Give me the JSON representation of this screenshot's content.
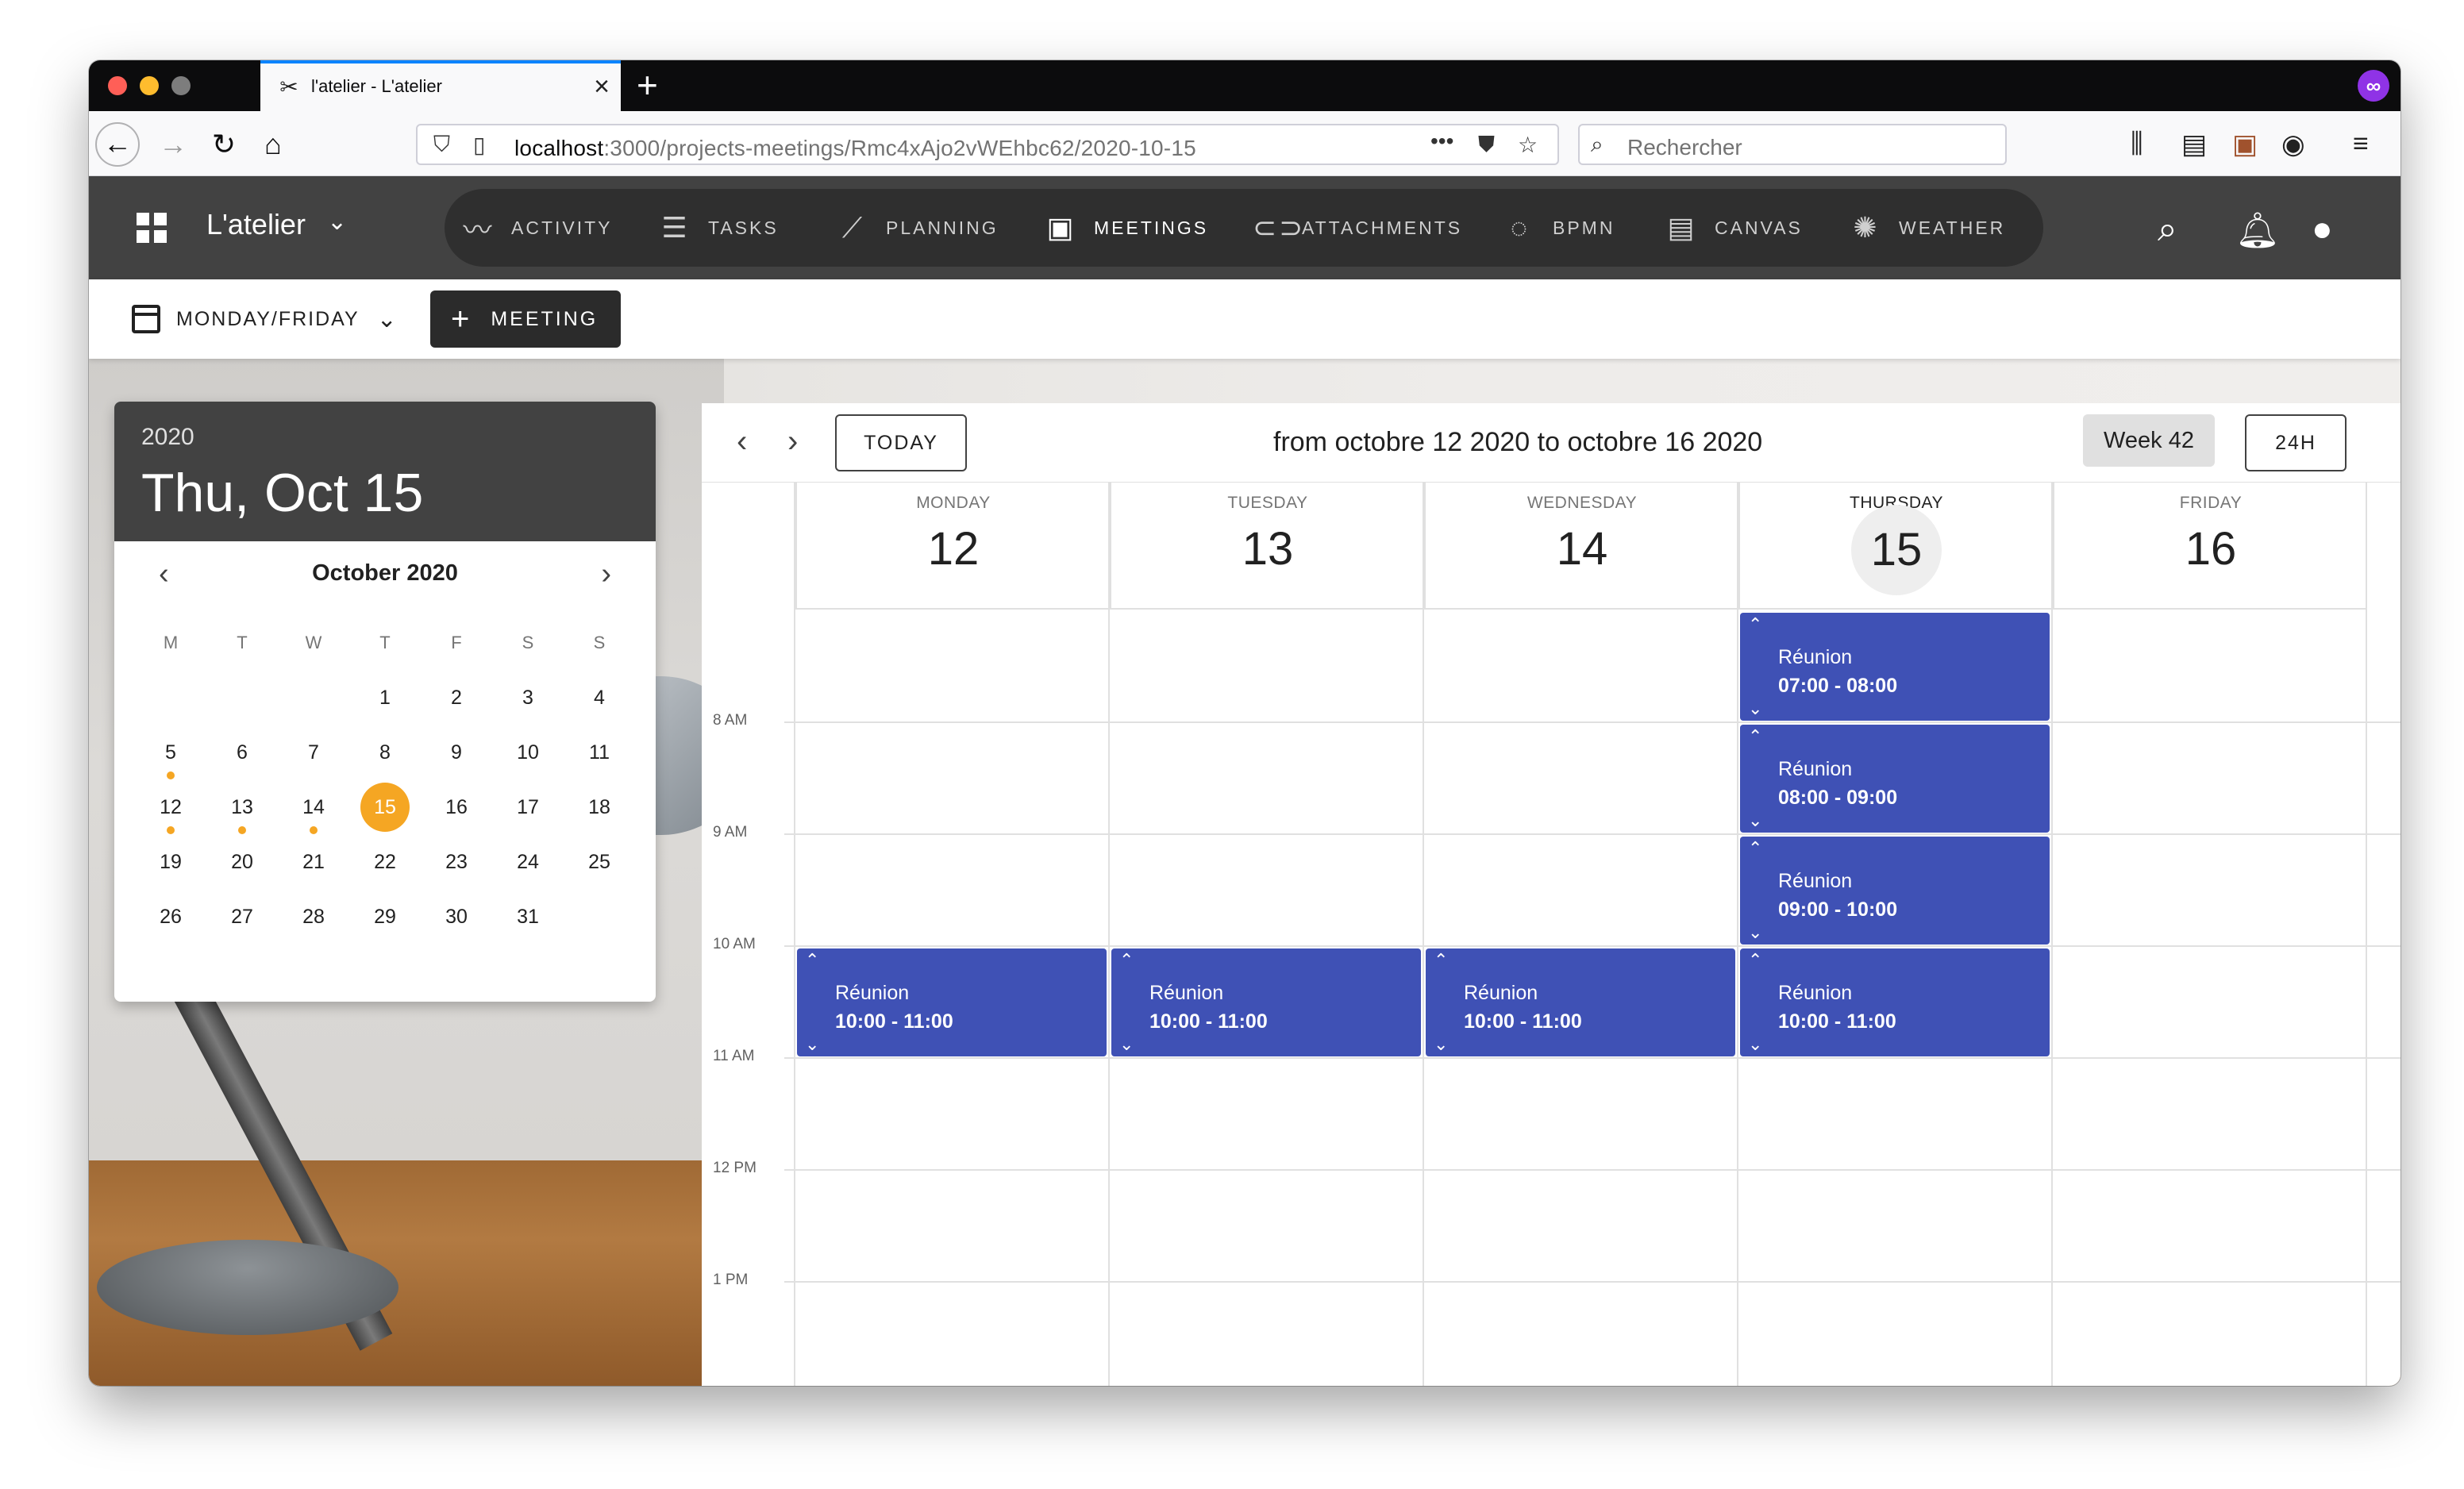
{
  "browser": {
    "tab_title": "l'atelier - L'atelier",
    "url_host": "localhost",
    "url_path": ":3000/projects-meetings/Rmc4xAjo2vWEhbc62/2020-10-15",
    "search_placeholder": "Rechercher"
  },
  "app": {
    "brand": "L'atelier",
    "nav": [
      {
        "label": "ACTIVITY",
        "icon": "activity-icon"
      },
      {
        "label": "TASKS",
        "icon": "list-icon"
      },
      {
        "label": "PLANNING",
        "icon": "trending-icon"
      },
      {
        "label": "MEETINGS",
        "icon": "calendar-star-icon"
      },
      {
        "label": "ATTACHMENTS",
        "icon": "attachment-icon"
      },
      {
        "label": "BPMN",
        "icon": "circle-icon"
      },
      {
        "label": "CANVAS",
        "icon": "canvas-icon"
      },
      {
        "label": "WEATHER",
        "icon": "sun-icon"
      }
    ],
    "active_nav": "MEETINGS"
  },
  "toolbar": {
    "view_select": "MONDAY/FRIDAY",
    "meeting_button": "MEETING"
  },
  "picker": {
    "year": "2020",
    "date": "Thu, Oct 15",
    "month": "October 2020",
    "weekdays": [
      "M",
      "T",
      "W",
      "T",
      "F",
      "S",
      "S"
    ],
    "weeks": [
      [
        "",
        "",
        "",
        "1",
        "2",
        "3",
        "4"
      ],
      [
        "5",
        "6",
        "7",
        "8",
        "9",
        "10",
        "11"
      ],
      [
        "12",
        "13",
        "14",
        "15",
        "16",
        "17",
        "18"
      ],
      [
        "19",
        "20",
        "21",
        "22",
        "23",
        "24",
        "25"
      ],
      [
        "26",
        "27",
        "28",
        "29",
        "30",
        "31",
        ""
      ]
    ],
    "selected_day": "15",
    "days_with_events": [
      "5",
      "12",
      "13",
      "14"
    ],
    "accent_color": "#f5a623"
  },
  "calendar": {
    "today_button": "TODAY",
    "title": "from octobre 12 2020 to octobre 16 2020",
    "week_chip": "Week 42",
    "range_button": "24H",
    "days": [
      {
        "name": "MONDAY",
        "num": "12"
      },
      {
        "name": "TUESDAY",
        "num": "13"
      },
      {
        "name": "WEDNESDAY",
        "num": "14"
      },
      {
        "name": "THURSDAY",
        "num": "15"
      },
      {
        "name": "FRIDAY",
        "num": "16"
      }
    ],
    "current_day": "THURSDAY",
    "time_labels": [
      "8 AM",
      "9 AM",
      "10 AM",
      "11 AM",
      "12 PM",
      "1 PM"
    ],
    "event_color": "#3f51b5",
    "events": [
      {
        "day": 3,
        "title": "Réunion",
        "time": "07:00 - 08:00"
      },
      {
        "day": 3,
        "title": "Réunion",
        "time": "08:00 - 09:00"
      },
      {
        "day": 3,
        "title": "Réunion",
        "time": "09:00 - 10:00"
      },
      {
        "day": 0,
        "title": "Réunion",
        "time": "10:00 - 11:00"
      },
      {
        "day": 1,
        "title": "Réunion",
        "time": "10:00 - 11:00"
      },
      {
        "day": 2,
        "title": "Réunion",
        "time": "10:00 - 11:00"
      },
      {
        "day": 3,
        "title": "Réunion",
        "time": "10:00 - 11:00"
      }
    ]
  }
}
